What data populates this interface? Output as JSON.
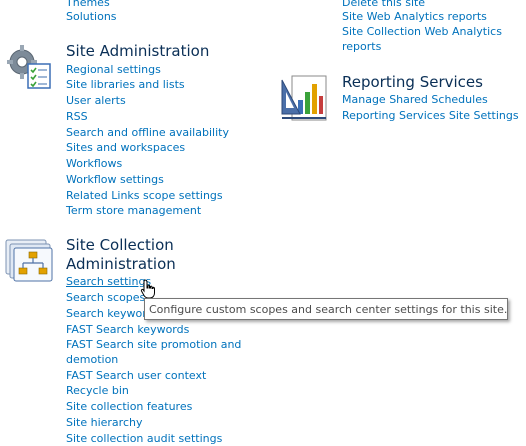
{
  "top_left_links": [
    "Themes",
    "Solutions"
  ],
  "top_right_links": [
    "Delete this site",
    "Site Web Analytics reports",
    "Site Collection Web Analytics",
    "reports"
  ],
  "site_admin": {
    "title": "Site Administration",
    "links": [
      "Regional settings",
      "Site libraries and lists",
      "User alerts",
      "RSS",
      "Search and offline availability",
      "Sites and workspaces",
      "Workflows",
      "Workflow settings",
      "Related Links scope settings",
      "Term store management"
    ]
  },
  "reporting": {
    "title": "Reporting Services",
    "links": [
      "Manage Shared Schedules",
      "Reporting Services Site Settings"
    ]
  },
  "site_collection": {
    "title_line1": "Site Collection",
    "title_line2": "Administration",
    "links": [
      "Search settings",
      "Search scopes",
      "Search keywords",
      "FAST Search keywords",
      "FAST Search site promotion and",
      "demotion",
      "FAST Search user context",
      "Recycle bin",
      "Site collection features",
      "Site hierarchy",
      "Site collection audit settings"
    ]
  },
  "tooltip": "Configure custom scopes and search center settings for this site.",
  "colors": {
    "link": "#0072bc",
    "heading": "#0a2f56"
  }
}
